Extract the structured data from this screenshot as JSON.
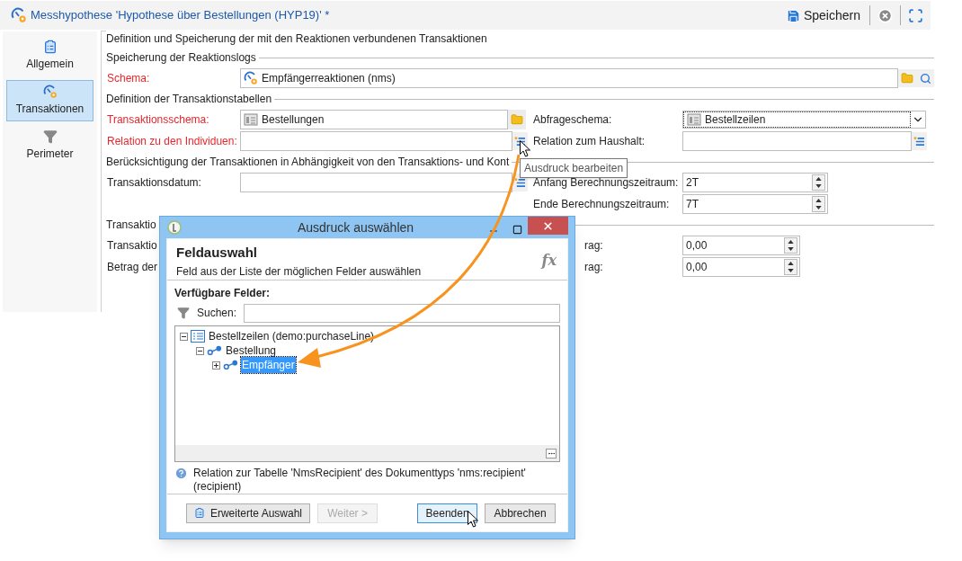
{
  "window": {
    "title": "Messhypothese 'Hypothese über Bestellungen (HYP19)' *"
  },
  "toolbar": {
    "save_label": "Speichern"
  },
  "sidebar": {
    "items": [
      {
        "label": "Allgemein",
        "kind": "general",
        "selected": false
      },
      {
        "label": "Transaktionen",
        "kind": "transactions",
        "selected": true
      },
      {
        "label": "Perimeter",
        "kind": "filter",
        "selected": false
      }
    ]
  },
  "form": {
    "title": "Definition und Speicherung der mit den Reaktionen verbundenen Transaktionen",
    "sections": [
      {
        "title": "Speicherung der Reaktionslogs",
        "rows": [
          {
            "left": {
              "label": "Schema:",
              "required": true,
              "kind": "schema",
              "value": "Empfängerreaktionen (nms)"
            }
          }
        ]
      },
      {
        "title": "Definition der Transaktionstabellen",
        "rows": [
          {
            "left": {
              "label": "Transaktionsschema:",
              "required": true,
              "kind": "folder",
              "value": "Bestellungen"
            },
            "right": {
              "label": "Abfrageschema:",
              "required": false,
              "kind": "select",
              "value": "Bestellzeilen"
            }
          },
          {
            "left": {
              "label": "Relation zu den Individuen:",
              "required": true,
              "kind": "expression"
            },
            "right": {
              "label": "Relation zum Haushalt:",
              "required": false,
              "kind": "expression"
            }
          }
        ]
      },
      {
        "title": "Berücksichtigung der Transaktionen in Abhängigkeit von den Transaktions- und Kont",
        "rows": [
          {
            "left": {
              "label": "Transaktionsdatum:",
              "required": false,
              "kind": "expression"
            },
            "right": {
              "label": "Anfang Berechnungszeitraum:",
              "required": false,
              "kind": "spinner",
              "value": "2T"
            }
          },
          {
            "right": {
              "label": "Ende Berechnungszeitraum:",
              "required": false,
              "kind": "spinner",
              "value": "7T"
            }
          }
        ]
      },
      {
        "title": "Transaktio",
        "rows": [
          {
            "left": {
              "label": "Transaktio",
              "required": false
            },
            "right": {
              "label": "rag:",
              "required": false,
              "kind": "amount",
              "value": "0,00"
            }
          },
          {
            "left": {
              "label": "Betrag der",
              "required": false
            },
            "right": {
              "label": "rag:",
              "required": false,
              "kind": "amount",
              "value": "0,00"
            }
          }
        ]
      }
    ]
  },
  "tooltip": "Ausdruck bearbeiten",
  "dialog": {
    "title": "Ausdruck auswählen",
    "heading": "Feldauswahl",
    "subheading": "Feld aus der Liste der möglichen Felder auswählen",
    "formula_glyph": "fx",
    "fields_label": "Verfügbare Felder:",
    "search": {
      "label": "Suchen:"
    },
    "tree": [
      {
        "label": "Bestellzeilen (demo:purchaseLine)",
        "kind": "table",
        "expanded": true,
        "selected": false,
        "children": [
          {
            "label": "Bestellung",
            "kind": "link",
            "expanded": true,
            "selected": false,
            "children": [
              {
                "label": "Empfänger",
                "kind": "link",
                "expanded": false,
                "selected": true
              }
            ]
          }
        ]
      }
    ],
    "help": "Relation zur Tabelle 'NmsRecipient' des Dokumenttyps 'nms:recipient' (recipient)",
    "buttons": [
      {
        "label": "Erweiterte Auswahl",
        "kind": "advanced",
        "disabled": false,
        "focused": false
      },
      {
        "label": "Weiter >",
        "kind": "plain",
        "disabled": true,
        "focused": false
      },
      {
        "label": "Beenden",
        "kind": "plain",
        "disabled": false,
        "focused": true
      },
      {
        "label": "Abbrechen",
        "kind": "plain",
        "disabled": false,
        "focused": false
      }
    ]
  }
}
